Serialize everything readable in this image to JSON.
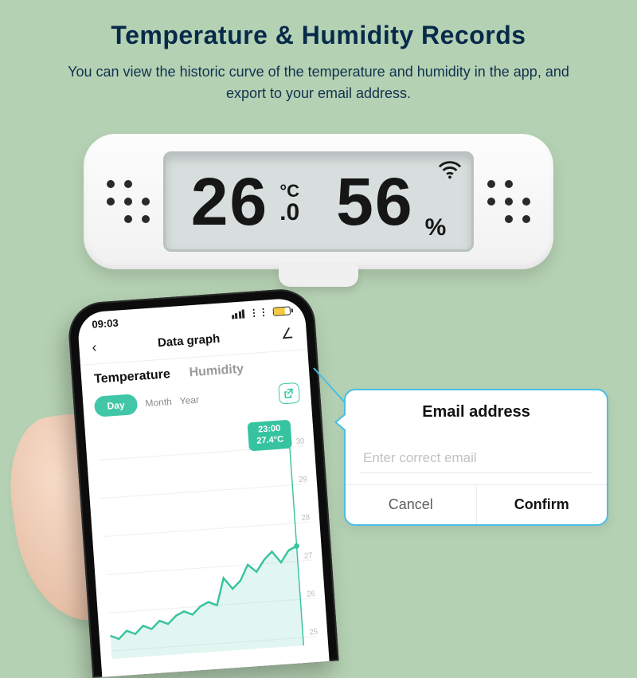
{
  "headline": "Temperature & Humidity Records",
  "subline": "You can view the historic curve of the temperature and  humidity in the app, and export to your email address.",
  "device": {
    "temp_main": "26",
    "temp_decimal_unit_top": "°C",
    "temp_decimal_unit_bot": ".0",
    "humidity": "56",
    "humidity_unit": "%"
  },
  "phone": {
    "time": "09:03",
    "header_title": "Data graph",
    "tabs": {
      "temperature": "Temperature",
      "humidity": "Humidity"
    },
    "ranges": {
      "day": "Day",
      "month": "Month",
      "year": "Year"
    },
    "tooltip_time": "23:00",
    "tooltip_value": "27.4°C",
    "ylabels": [
      "30",
      "29",
      "28",
      "27",
      "26",
      "25"
    ]
  },
  "popup": {
    "title": "Email address",
    "placeholder": "Enter correct email",
    "cancel": "Cancel",
    "confirm": "Confirm"
  },
  "chart_data": {
    "type": "line",
    "title": "Temperature — Day",
    "xlabel": "",
    "ylabel": "°C",
    "ylim": [
      25,
      30
    ],
    "x": [
      0,
      1,
      2,
      3,
      4,
      5,
      6,
      7,
      8,
      9,
      10,
      11,
      12,
      13,
      14,
      15,
      16,
      17,
      18,
      19,
      20,
      21,
      22,
      23
    ],
    "values": [
      25.4,
      25.3,
      25.5,
      25.4,
      25.6,
      25.5,
      25.7,
      25.6,
      25.8,
      25.9,
      25.8,
      26.0,
      26.1,
      26.0,
      26.7,
      26.4,
      26.6,
      27.0,
      26.8,
      27.1,
      27.3,
      27.0,
      27.3,
      27.4
    ],
    "highlight": {
      "x": 23,
      "time": "23:00",
      "value": 27.4
    }
  }
}
